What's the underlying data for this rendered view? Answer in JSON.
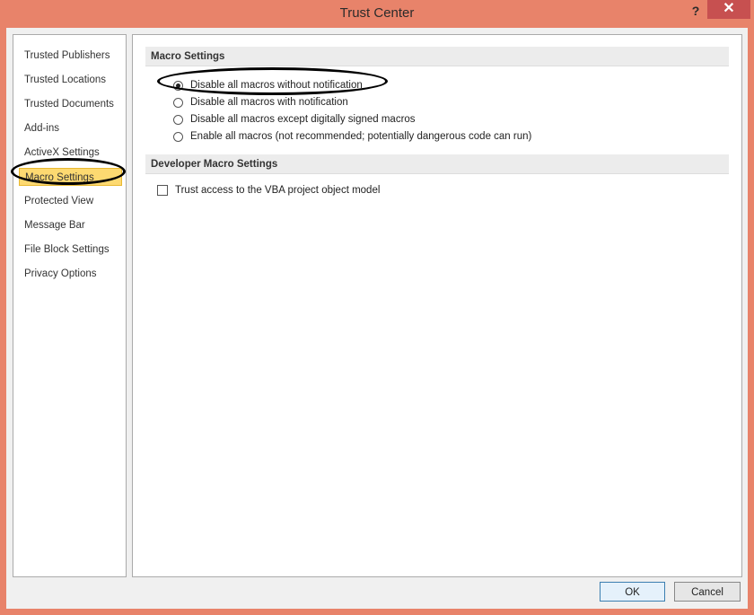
{
  "window": {
    "title": "Trust Center",
    "help_label": "?",
    "close_label": "✕",
    "accent_color": "#e8836a"
  },
  "sidebar": {
    "items": [
      {
        "label": "Trusted Publishers"
      },
      {
        "label": "Trusted Locations"
      },
      {
        "label": "Trusted Documents"
      },
      {
        "label": "Add-ins"
      },
      {
        "label": "ActiveX Settings"
      },
      {
        "label": "Macro Settings",
        "selected": true
      },
      {
        "label": "Protected View"
      },
      {
        "label": "Message Bar"
      },
      {
        "label": "File Block Settings"
      },
      {
        "label": "Privacy Options"
      }
    ]
  },
  "main": {
    "macro_section": {
      "header": "Macro Settings",
      "options": [
        {
          "label": "Disable all macros without notification",
          "checked": true
        },
        {
          "label": "Disable all macros with notification",
          "checked": false
        },
        {
          "label": "Disable all macros except digitally signed macros",
          "checked": false
        },
        {
          "label": "Enable all macros (not recommended; potentially dangerous code can run)",
          "checked": false
        }
      ]
    },
    "developer_section": {
      "header": "Developer Macro Settings",
      "checkbox_label": "Trust access to the VBA project object model",
      "checked": false
    }
  },
  "footer": {
    "ok_label": "OK",
    "cancel_label": "Cancel"
  }
}
